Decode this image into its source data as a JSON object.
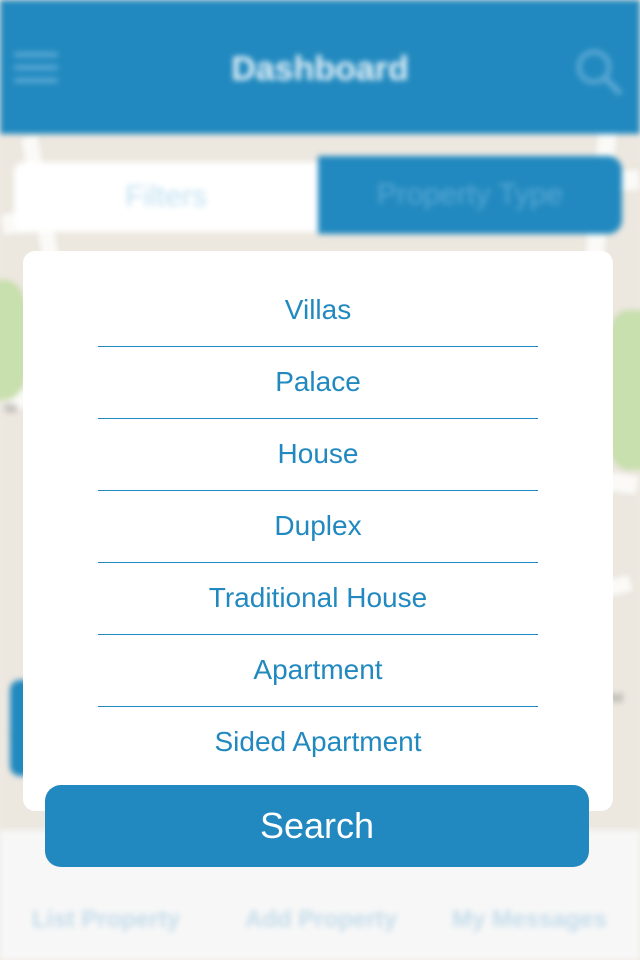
{
  "header": {
    "title": "Dashboard"
  },
  "segments": {
    "filters": "Filters",
    "property_type": "Property Type"
  },
  "property_types": [
    "Villas",
    "Palace",
    "House",
    "Duplex",
    "Traditional House",
    "Apartment",
    "Sided Apartment"
  ],
  "actions": {
    "search": "Search"
  },
  "bottom_nav": {
    "items": [
      "List Property",
      "Add Property",
      "My Messages"
    ]
  },
  "colors": {
    "accent": "#2189bf",
    "modal_bg": "#ffffff",
    "button_text": "#ffffff"
  }
}
